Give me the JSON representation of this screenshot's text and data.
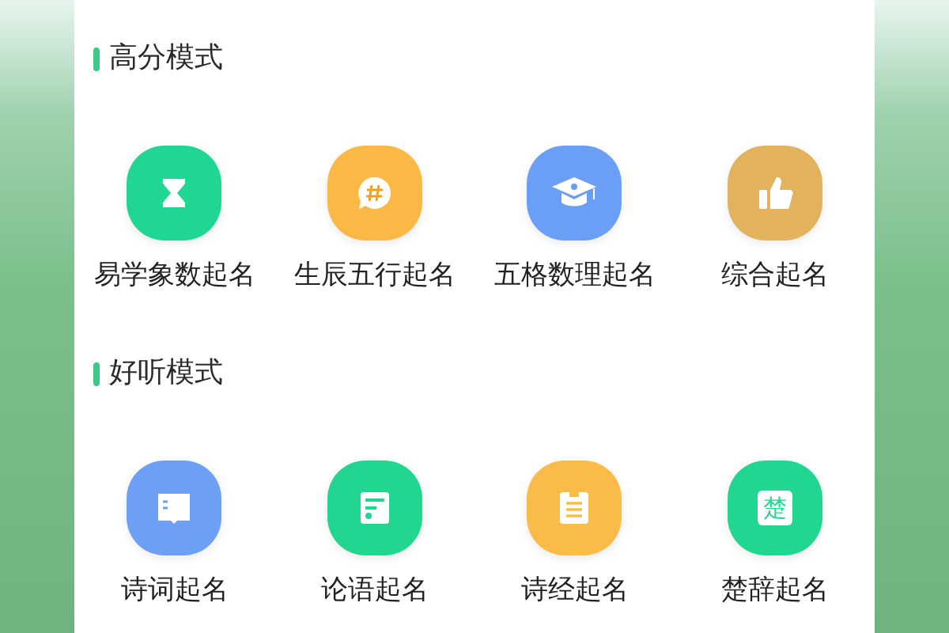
{
  "sections": [
    {
      "title": "高分模式",
      "items": [
        {
          "label": "易学象数起名",
          "kind": "hourglass",
          "color": "#1fd792"
        },
        {
          "label": "生辰五行起名",
          "kind": "chat",
          "color": "#fbb844"
        },
        {
          "label": "五格数理起名",
          "kind": "cap",
          "color": "#6b9ff7"
        },
        {
          "label": "综合起名",
          "kind": "thumb",
          "color": "#e3b25c"
        }
      ]
    },
    {
      "title": "好听模式",
      "items": [
        {
          "label": "诗词起名",
          "kind": "book",
          "color": "#6e9ff6"
        },
        {
          "label": "论语起名",
          "kind": "doc",
          "color": "#22d690"
        },
        {
          "label": "诗经起名",
          "kind": "clipboard",
          "color": "#fbbb48"
        },
        {
          "label": "楚辞起名",
          "kind": "glyph",
          "glyph": "楚",
          "color": "#21d690"
        }
      ]
    }
  ]
}
